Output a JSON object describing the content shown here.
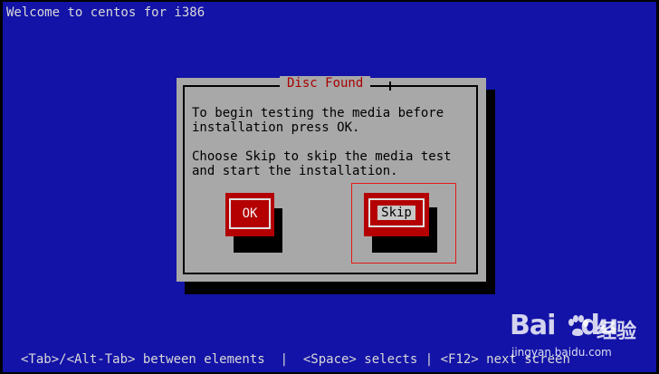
{
  "header": {
    "title": "Welcome to centos for i386"
  },
  "dialog": {
    "title": "Disc Found",
    "message_lines": [
      "To begin testing the media before",
      "installation press OK.",
      "",
      "Choose Skip to skip the media test",
      "and start the installation."
    ],
    "buttons": {
      "ok": "OK",
      "skip": "Skip"
    },
    "focused_button": "skip"
  },
  "footer": {
    "help": "<Tab>/<Alt-Tab> between elements  |  <Space> selects | <F12> next screen"
  },
  "watermark": {
    "logo_text": "Bai",
    "logo_suffix": "du",
    "cn_text": "经验",
    "url": "jingyan.baidu.com"
  },
  "colors": {
    "background": "#1313a7",
    "dialog": "#a8a8a8",
    "button": "#b40000",
    "title_text": "#a80000",
    "focus_outline": "#e41818"
  }
}
